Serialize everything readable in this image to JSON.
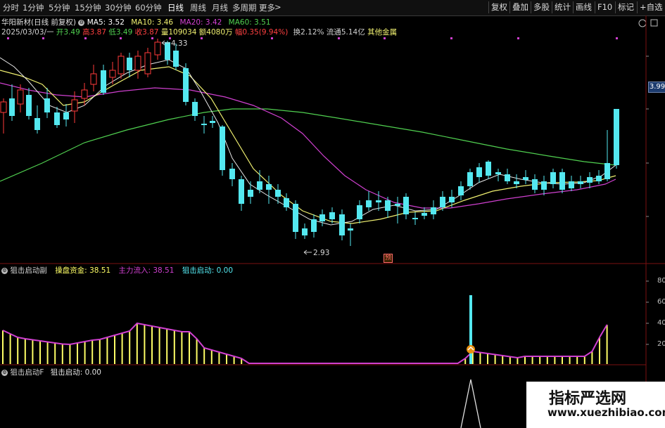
{
  "toolbar": {
    "periods": [
      "分时",
      "1分钟",
      "5分钟",
      "15分钟",
      "30分钟",
      "60分钟",
      "日线",
      "周线",
      "月线",
      "多周期",
      "更多"
    ],
    "active_period": "日线",
    "more_arrow": ">",
    "right_buttons": [
      "复权",
      "叠加",
      "多股",
      "统计",
      "画线",
      "F10",
      "标记",
      "+自选"
    ]
  },
  "header": {
    "stock": "华阳新材(日线 前复权)",
    "ma5": "MA5: 3.52",
    "ma10": "MA10: 3.46",
    "ma20": "MA20: 3.42",
    "ma60": "MA60: 3.51",
    "date": "2025/03/03/一",
    "open": "开3.49",
    "high": "高3.87",
    "low": "低3.49",
    "close": "收3.87",
    "volume": "量109034",
    "amount": "额4080万",
    "change": "幅0.35(9.94%)",
    "turnover": "换2.12%",
    "float": "流通5.14亿",
    "sector": "其他金属"
  },
  "price_chart": {
    "high_label": "4.33",
    "low_label": "2.93",
    "pre_marker": "预",
    "current_price": "3.99"
  },
  "indicator1": {
    "name": "狙击启动副",
    "field1": "操盘资金: 38.51",
    "field2": "主力流入: 38.51",
    "field3": "狙击启动: 0.00",
    "axis": [
      "80",
      "60",
      "40",
      "20"
    ]
  },
  "indicator2": {
    "name": "狙击启动F",
    "field1": "狙击启动: 0.00"
  },
  "watermark": {
    "line1": "指标严选网",
    "line2": "www.xuezhibiao.com"
  },
  "colors": {
    "up": "#ff3a3a",
    "down": "#54e8f0",
    "ma5": "#ffffff",
    "ma10": "#f0f070",
    "ma20": "#d040d0",
    "ma60": "#50d050",
    "bar": "#ffff66",
    "flow": "#d040d0"
  }
}
